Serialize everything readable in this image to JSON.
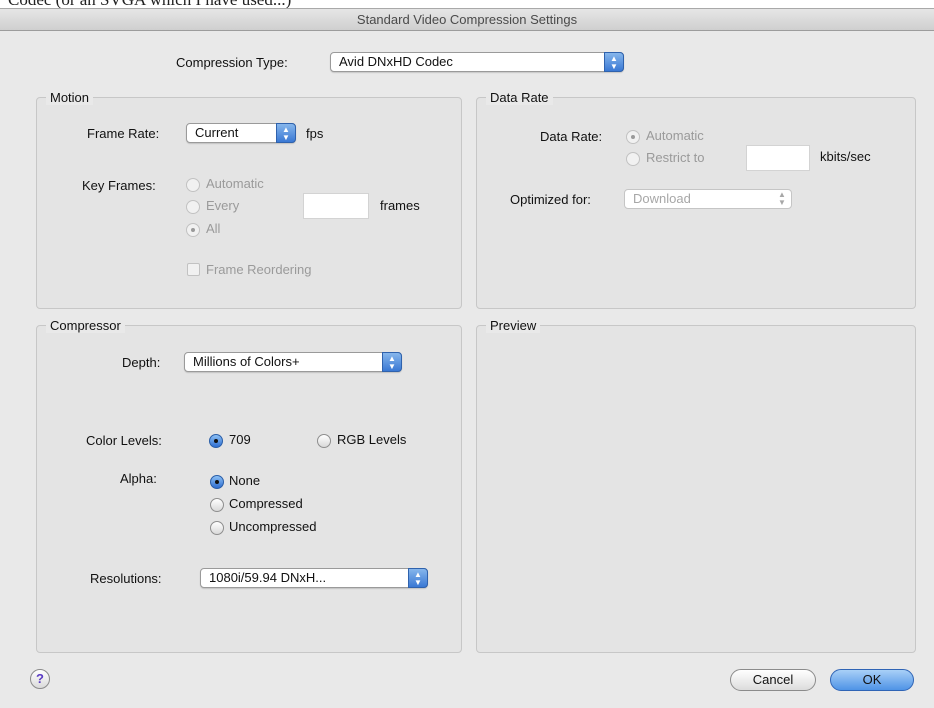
{
  "top_fragment": "Codec (or an SVGA which I have used...)",
  "dialog": {
    "title": "Standard Video Compression Settings",
    "compression_type": {
      "label": "Compression Type:",
      "value": "Avid DNxHD Codec"
    },
    "motion": {
      "title": "Motion",
      "frame_rate": {
        "label": "Frame Rate:",
        "value": "Current",
        "unit": "fps"
      },
      "key_frames": {
        "label": "Key Frames:",
        "options": [
          "Automatic",
          "Every",
          "All"
        ],
        "selected": "All",
        "every_unit": "frames",
        "every_value": ""
      },
      "frame_reordering": "Frame Reordering"
    },
    "data_rate": {
      "title": "Data Rate",
      "label": "Data Rate:",
      "options": [
        "Automatic",
        "Restrict to"
      ],
      "selected": "Automatic",
      "unit": "kbits/sec",
      "value": "",
      "optimized_for": {
        "label": "Optimized for:",
        "value": "Download"
      }
    },
    "compressor": {
      "title": "Compressor",
      "depth": {
        "label": "Depth:",
        "value": "Millions of Colors+"
      },
      "color_levels": {
        "label": "Color Levels:",
        "options": [
          "709",
          "RGB Levels"
        ],
        "selected": "709"
      },
      "alpha": {
        "label": "Alpha:",
        "options": [
          "None",
          "Compressed",
          "Uncompressed"
        ],
        "selected": "None"
      },
      "resolutions": {
        "label": "Resolutions:",
        "value": "1080i/59.94  DNxH..."
      }
    },
    "preview": {
      "title": "Preview"
    },
    "buttons": {
      "help": "?",
      "cancel": "Cancel",
      "ok": "OK"
    }
  },
  "colors": {
    "accent": "#3a78d4",
    "dialog_bg": "#e9e9e9",
    "help_glyph": "#5b3cc4"
  }
}
